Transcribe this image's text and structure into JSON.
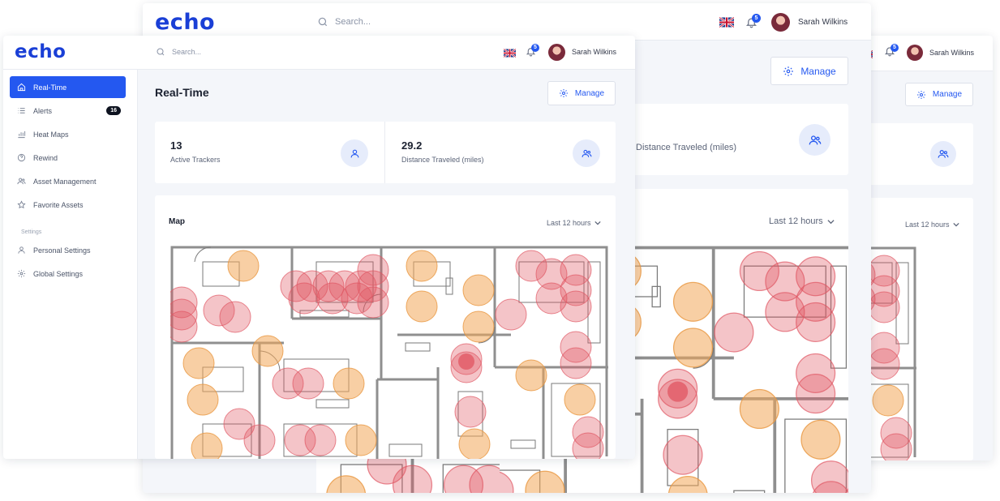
{
  "app": {
    "logo": "echo"
  },
  "header": {
    "search_placeholder": "Search...",
    "notification_count": "5",
    "user_name": "Sarah Wilkins",
    "flag_icon": "uk-flag-icon"
  },
  "sidebar": {
    "items": [
      {
        "label": "Real-Time",
        "icon": "home-icon",
        "active": true
      },
      {
        "label": "Alerts",
        "icon": "list-icon",
        "count": "16"
      },
      {
        "label": "Heat Maps",
        "icon": "bar-chart-icon"
      },
      {
        "label": "Rewind",
        "icon": "help-circle-icon"
      },
      {
        "label": "Asset Management",
        "icon": "users-icon"
      },
      {
        "label": "Favorite Assets",
        "icon": "star-icon"
      }
    ],
    "settings_label": "Settings",
    "settings_items": [
      {
        "label": "Personal Settings",
        "icon": "user-icon"
      },
      {
        "label": "Global Settings",
        "icon": "gear-icon"
      }
    ]
  },
  "page": {
    "title": "Real-Time",
    "manage_label": "Manage"
  },
  "stats": [
    {
      "value": "13",
      "label": "Active Trackers",
      "icon": "user-icon"
    },
    {
      "value": "29.2",
      "label": "Distance Traveled (miles)",
      "icon": "users-icon"
    }
  ],
  "map": {
    "title": "Map",
    "range_label": "Last 12 hours"
  },
  "colors": {
    "accent": "#2458f0",
    "heat_high": "#e05562",
    "heat_mid": "#f2a85a"
  }
}
